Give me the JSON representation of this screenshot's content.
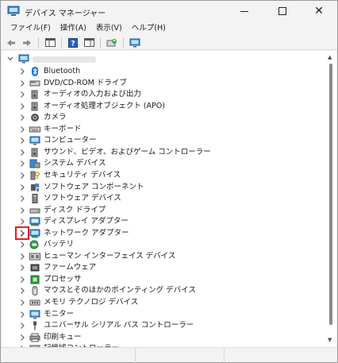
{
  "window": {
    "title": "デバイス マネージャー"
  },
  "menubar": [
    "ファイル(F)",
    "操作(A)",
    "表示(V)",
    "ヘルプ(H)"
  ],
  "toolbar": {
    "buttons": [
      "back-icon",
      "forward-icon",
      "properties-pane-icon",
      "help-icon",
      "action-pane-icon",
      "update-driver-icon",
      "scan-hardware-icon"
    ]
  },
  "tree": {
    "items": [
      {
        "label": "Bluetooth",
        "icon": "bluetooth-icon"
      },
      {
        "label": "DVD/CD-ROM ドライブ",
        "icon": "dvd-drive-icon"
      },
      {
        "label": "オーディオの入力および出力",
        "icon": "speaker-icon"
      },
      {
        "label": "オーディオ処理オブジェクト (APO)",
        "icon": "speaker-icon"
      },
      {
        "label": "カメラ",
        "icon": "camera-icon"
      },
      {
        "label": "キーボード",
        "icon": "keyboard-icon"
      },
      {
        "label": "コンピューター",
        "icon": "computer-icon"
      },
      {
        "label": "サウンド、ビデオ、およびゲーム コントローラー",
        "icon": "speaker-icon"
      },
      {
        "label": "システム デバイス",
        "icon": "system-device-icon"
      },
      {
        "label": "セキュリティ デバイス",
        "icon": "security-icon"
      },
      {
        "label": "ソフトウェア コンポーネント",
        "icon": "software-component-icon"
      },
      {
        "label": "ソフトウェア デバイス",
        "icon": "software-device-icon"
      },
      {
        "label": "ディスク ドライブ",
        "icon": "disk-drive-icon"
      },
      {
        "label": "ディスプレイ アダプター",
        "icon": "display-adapter-icon"
      },
      {
        "label": "ネットワーク アダプター",
        "icon": "network-adapter-icon"
      },
      {
        "label": "バッテリ",
        "icon": "battery-icon"
      },
      {
        "label": "ヒューマン インターフェイス デバイス",
        "icon": "hid-icon"
      },
      {
        "label": "ファームウェア",
        "icon": "firmware-icon"
      },
      {
        "label": "プロセッサ",
        "icon": "processor-icon"
      },
      {
        "label": "マウスとそのほかのポインティング デバイス",
        "icon": "mouse-icon"
      },
      {
        "label": "メモリ テクノロジ デバイス",
        "icon": "memory-icon"
      },
      {
        "label": "モニター",
        "icon": "monitor-icon"
      },
      {
        "label": "ユニバーサル シリアル バス コントローラー",
        "icon": "usb-icon"
      },
      {
        "label": "印刷キュー",
        "icon": "printer-icon"
      },
      {
        "label": "記憶域コントローラー",
        "icon": "storage-controller-icon"
      }
    ]
  },
  "colors": {
    "highlight": "#e0211c",
    "accent": "#1e78d4"
  }
}
